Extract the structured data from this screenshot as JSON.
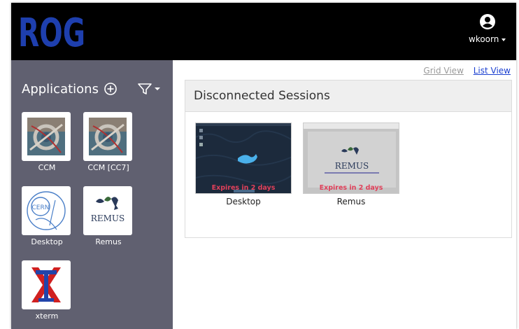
{
  "header": {
    "logo_text": "ROG",
    "username": "wkoorn"
  },
  "sidebar": {
    "title": "Applications",
    "apps": [
      {
        "label": "CCM"
      },
      {
        "label": "CCM [CC7]"
      },
      {
        "label": "Desktop",
        "logo_text": "CERN"
      },
      {
        "label": "Remus",
        "logo_text": "REMUS"
      },
      {
        "label": "xterm"
      }
    ]
  },
  "main": {
    "grid_view_label": "Grid View",
    "list_view_label": "List View",
    "section_title": "Disconnected Sessions",
    "sessions": [
      {
        "label": "Desktop",
        "expires": "Expires in 2 days"
      },
      {
        "label": "Remus",
        "expires": "Expires in 2 days",
        "logo_text": "REMUS"
      }
    ]
  },
  "colors": {
    "topbar": "#000000",
    "logo": "#1e3fae",
    "sidebar": "#606070",
    "expires": "#e0405a",
    "list_view_link": "#1a3fd0"
  }
}
